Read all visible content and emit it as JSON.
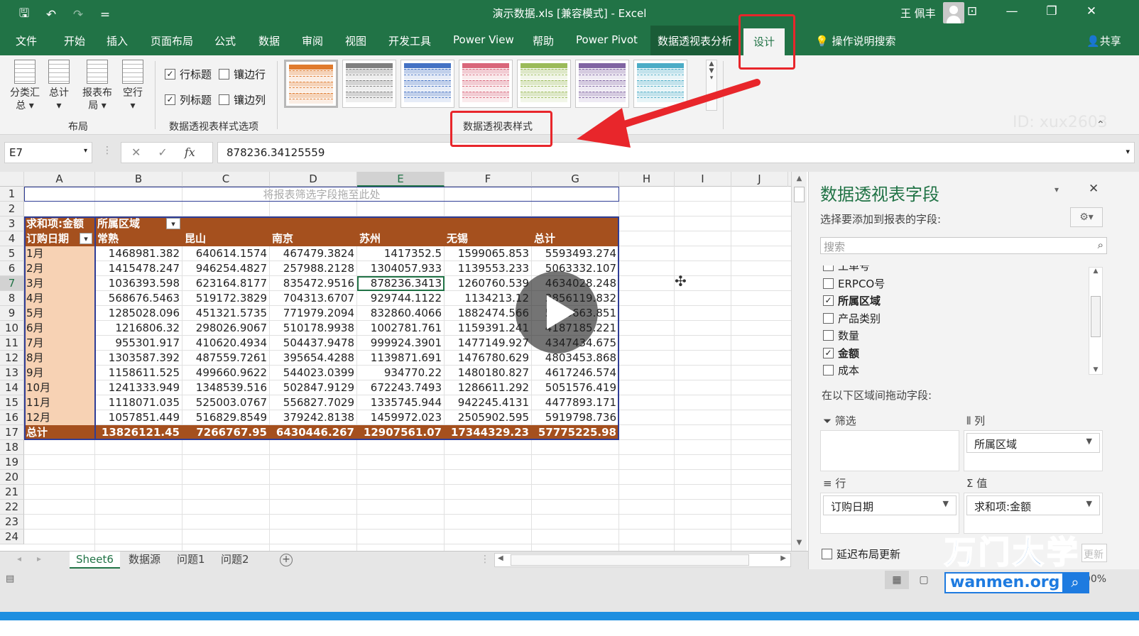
{
  "window": {
    "title": "演示数据.xls [兼容模式] - Excel",
    "user": "王 佩丰",
    "qat": {
      "save": "🖫",
      "undo": "↶",
      "redo": "↷",
      "custom": "="
    },
    "controls": {
      "ribbon_display": "⊡",
      "minimize": "—",
      "restore": "❐",
      "close": "✕"
    }
  },
  "ribbon": {
    "tabs": [
      "文件",
      "开始",
      "插入",
      "页面布局",
      "公式",
      "数据",
      "审阅",
      "视图",
      "开发工具",
      "Power View",
      "帮助",
      "Power Pivot"
    ],
    "context_tab": "数据透视表分析",
    "active_tab": "设计",
    "help": "操作说明搜索",
    "share": "共享",
    "layout_buttons": [
      "分类汇总",
      "总计",
      "报表布局",
      "空行"
    ],
    "layout_button_lines": [
      [
        "分类汇",
        "总 ▾"
      ],
      [
        "总计",
        "▾"
      ],
      [
        "报表布",
        "局 ▾"
      ],
      [
        "空行",
        "▾"
      ]
    ],
    "groups": {
      "layout": "布局",
      "style_options": "数据透视表样式选项",
      "styles": "数据透视表样式"
    },
    "options": [
      {
        "label": "行标题",
        "checked": true
      },
      {
        "label": "镶边行",
        "checked": false
      },
      {
        "label": "列标题",
        "checked": true
      },
      {
        "label": "镶边列",
        "checked": false
      }
    ],
    "style_colors": [
      "#e07b2e",
      "#7f7f7f",
      "#4472c4",
      "#d9667a",
      "#9bbb59",
      "#8064a2",
      "#4bacc6"
    ]
  },
  "formula_bar": {
    "name_box": "E7",
    "fx": "fx",
    "cancel": "✕",
    "enter": "✓",
    "value": "878236.34125559"
  },
  "sheet": {
    "columns": [
      "A",
      "B",
      "C",
      "D",
      "E",
      "F",
      "G",
      "H",
      "I",
      "J"
    ],
    "selected_column": "E",
    "rows": [
      "1",
      "2",
      "3",
      "4",
      "5",
      "6",
      "7",
      "8",
      "9",
      "10",
      "11",
      "12",
      "13",
      "14",
      "15",
      "16",
      "17",
      "18",
      "19",
      "20",
      "21",
      "22",
      "23",
      "24"
    ],
    "selected_row": "7",
    "filter_hint": "将报表筛选字段拖至此处",
    "pivot": {
      "title_cell": "求和项:金额",
      "col_field": "所属区域",
      "row_field": "订购日期",
      "col_headers": [
        "常熟",
        "昆山",
        "南京",
        "苏州",
        "无锡",
        "总计"
      ],
      "rows": [
        {
          "label": "1月",
          "values": [
            "1468981.382",
            "640614.1574",
            "467479.3824",
            "1417352.5",
            "1599065.853",
            "5593493.274"
          ]
        },
        {
          "label": "2月",
          "values": [
            "1415478.247",
            "946254.4827",
            "257988.2128",
            "1304057.933",
            "1139553.233",
            "5063332.107"
          ]
        },
        {
          "label": "3月",
          "values": [
            "1036393.598",
            "623164.8177",
            "835472.9516",
            "878236.3413",
            "1260760.539",
            "4634028.248"
          ]
        },
        {
          "label": "4月",
          "values": [
            "568676.5463",
            "519172.3829",
            "704313.6707",
            "929744.1122",
            "1134213.12",
            "3856119.832"
          ]
        },
        {
          "label": "5月",
          "values": [
            "1285028.096",
            "451321.5735",
            "771979.2094",
            "832860.4066",
            "1882474.566",
            "5223663.851"
          ]
        },
        {
          "label": "6月",
          "values": [
            "1216806.32",
            "298026.9067",
            "510178.9938",
            "1002781.761",
            "1159391.241",
            "4187185.221"
          ]
        },
        {
          "label": "7月",
          "values": [
            "955301.917",
            "410620.4934",
            "504437.9478",
            "999924.3901",
            "1477149.927",
            "4347434.675"
          ]
        },
        {
          "label": "8月",
          "values": [
            "1303587.392",
            "487559.7261",
            "395654.4288",
            "1139871.691",
            "1476780.629",
            "4803453.868"
          ]
        },
        {
          "label": "9月",
          "values": [
            "1158611.525",
            "499660.9622",
            "544023.0399",
            "934770.22",
            "1480180.827",
            "4617246.574"
          ]
        },
        {
          "label": "10月",
          "values": [
            "1241333.949",
            "1348539.516",
            "502847.9129",
            "672243.7493",
            "1286611.292",
            "5051576.419"
          ]
        },
        {
          "label": "11月",
          "values": [
            "1118071.035",
            "525003.0767",
            "556827.7029",
            "1335745.944",
            "942245.4131",
            "4477893.171"
          ]
        },
        {
          "label": "12月",
          "values": [
            "1057851.449",
            "516829.8549",
            "379242.8138",
            "1459972.023",
            "2505902.595",
            "5919798.736"
          ]
        }
      ],
      "total": {
        "label": "总计",
        "values": [
          "13826121.45",
          "7266767.95",
          "6430446.267",
          "12907561.07",
          "17344329.23",
          "57775225.98"
        ]
      }
    },
    "tabs": [
      "Sheet6",
      "数据源",
      "问题1",
      "问题2"
    ],
    "active_tab": "Sheet6",
    "add_sheet": "+"
  },
  "pivot_pane": {
    "title": "数据透视表字段",
    "subtitle": "选择要添加到报表的字段:",
    "search_placeholder": "搜索",
    "fields": [
      {
        "label": "工单号",
        "checked": false
      },
      {
        "label": "ERPCO号",
        "checked": false
      },
      {
        "label": "所属区域",
        "checked": true
      },
      {
        "label": "产品类别",
        "checked": false
      },
      {
        "label": "数量",
        "checked": false
      },
      {
        "label": "金额",
        "checked": true
      },
      {
        "label": "成本",
        "checked": false
      }
    ],
    "drag_hint": "在以下区域间拖动字段:",
    "areas": {
      "filter": "筛选",
      "columns": "列",
      "rows": "行",
      "values": "值"
    },
    "columns_value": "所属区域",
    "rows_value": "订购日期",
    "values_value": "求和项:金额",
    "defer": "延迟布局更新",
    "update": "更新"
  },
  "status": {
    "zoom": "100%"
  },
  "watermark": {
    "text": "万门大学",
    "url": "wanmen.org",
    "faint": "ID: xux2603"
  }
}
